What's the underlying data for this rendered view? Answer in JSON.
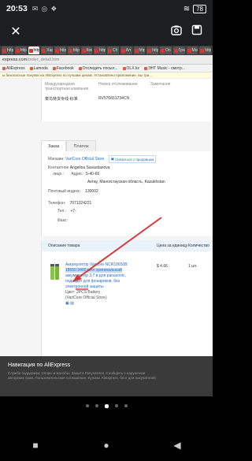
{
  "status": {
    "time": "20:53",
    "battery": "78"
  },
  "browser": {
    "tabs": [
      "https",
      "https",
      "https",
      "Хар",
      "https",
      "https",
      "Ком",
      "https",
      "Ch",
      "Ал",
      "https",
      "https",
      "On",
      "Гра",
      "Мое",
      "https"
    ],
    "url_host": "express.com",
    "url_path": "/order_detail.htm",
    "bookmarks": [
      "AliExpress",
      "Lamoda",
      "Facebook",
      "Отследить посыл...",
      "OLX.kz",
      "ЭНТ Music - смотр..."
    ],
    "banner": "ы безопасные покупки на AliExpress по лучшим ценам. Установлено приложение, вы три..."
  },
  "shipping": {
    "col1": "Международная транспортная компания",
    "col2": "Номер отслеживания",
    "col3": "Замечания",
    "carrier": "菜鸟特货专线-标准",
    "tracking": "RV576651734CN"
  },
  "tabs2": [
    "Заказ",
    "Платеж"
  ],
  "shop": {
    "label": "Магазин:",
    "name": "VariCore Official Store",
    "chat": "Связаться с продавцом"
  },
  "contact": {
    "title": "Контактное",
    "name": "Angelina Savastianova",
    "face_label": "лицо :",
    "address_label": "Адрес :",
    "address1": "5-40-66",
    "address2": "Актау, Мангистауская область, Kazakhstan",
    "postal_label": "Почтовый индекс:",
    "postal": "130002",
    "phone_label": "Телефон:",
    "phone": "7071324221",
    "mobile_label": "Тел.:",
    "mobile": "+7-",
    "fax_label": "Факс:"
  },
  "table": {
    "desc": "Описание товара",
    "price": "Цена за единицу",
    "qty": "Количество"
  },
  "product": {
    "line1": "Аккумулятор Varicore NCR18650B",
    "line2": "18650 3400 мАч оригинальный",
    "line3": "аккумулятор 3,7 в для panasonic,",
    "line4": "подходит для фонариков, без",
    "line5": "электронной защиты",
    "color": "Цвет: 2PCS Battery",
    "store": "(VariCore Official Store)",
    "price": "$ 4.66",
    "qty": "1 шт."
  },
  "footer": {
    "nav": "Навигация по AliExpress",
    "links1": "Служба поддержки, Споры и жалобы, Защита Покупателя, Сообщить о нарушении",
    "links2": "авторских прав, Пользовательское соглашение, Купоны AliExpress, блог для покупателей"
  },
  "colors": {
    "accent": "#2a6fc0",
    "arrow": "#d43a3a"
  }
}
